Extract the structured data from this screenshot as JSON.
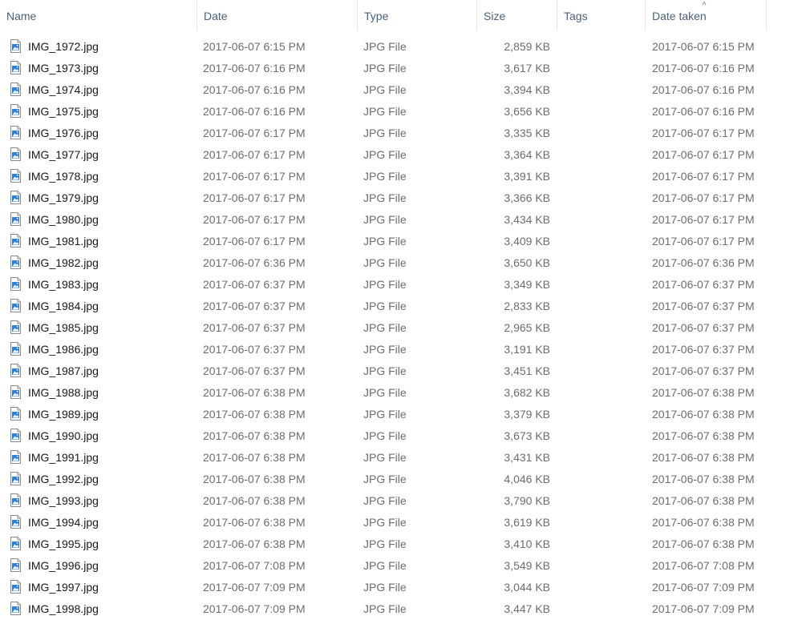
{
  "columns": {
    "name": "Name",
    "date": "Date",
    "type": "Type",
    "size": "Size",
    "tags": "Tags",
    "date_taken": "Date taken",
    "sort_indicator": "^"
  },
  "accent_color": "#4c607a",
  "file_icon": "image-file-icon",
  "files": [
    {
      "name": "IMG_1972.jpg",
      "date": "2017-06-07 6:15 PM",
      "type": "JPG File",
      "size": "2,859 KB",
      "tags": "",
      "date_taken": "2017-06-07 6:15 PM"
    },
    {
      "name": "IMG_1973.jpg",
      "date": "2017-06-07 6:16 PM",
      "type": "JPG File",
      "size": "3,617 KB",
      "tags": "",
      "date_taken": "2017-06-07 6:16 PM"
    },
    {
      "name": "IMG_1974.jpg",
      "date": "2017-06-07 6:16 PM",
      "type": "JPG File",
      "size": "3,394 KB",
      "tags": "",
      "date_taken": "2017-06-07 6:16 PM"
    },
    {
      "name": "IMG_1975.jpg",
      "date": "2017-06-07 6:16 PM",
      "type": "JPG File",
      "size": "3,656 KB",
      "tags": "",
      "date_taken": "2017-06-07 6:16 PM"
    },
    {
      "name": "IMG_1976.jpg",
      "date": "2017-06-07 6:17 PM",
      "type": "JPG File",
      "size": "3,335 KB",
      "tags": "",
      "date_taken": "2017-06-07 6:17 PM"
    },
    {
      "name": "IMG_1977.jpg",
      "date": "2017-06-07 6:17 PM",
      "type": "JPG File",
      "size": "3,364 KB",
      "tags": "",
      "date_taken": "2017-06-07 6:17 PM"
    },
    {
      "name": "IMG_1978.jpg",
      "date": "2017-06-07 6:17 PM",
      "type": "JPG File",
      "size": "3,391 KB",
      "tags": "",
      "date_taken": "2017-06-07 6:17 PM"
    },
    {
      "name": "IMG_1979.jpg",
      "date": "2017-06-07 6:17 PM",
      "type": "JPG File",
      "size": "3,366 KB",
      "tags": "",
      "date_taken": "2017-06-07 6:17 PM"
    },
    {
      "name": "IMG_1980.jpg",
      "date": "2017-06-07 6:17 PM",
      "type": "JPG File",
      "size": "3,434 KB",
      "tags": "",
      "date_taken": "2017-06-07 6:17 PM"
    },
    {
      "name": "IMG_1981.jpg",
      "date": "2017-06-07 6:17 PM",
      "type": "JPG File",
      "size": "3,409 KB",
      "tags": "",
      "date_taken": "2017-06-07 6:17 PM"
    },
    {
      "name": "IMG_1982.jpg",
      "date": "2017-06-07 6:36 PM",
      "type": "JPG File",
      "size": "3,650 KB",
      "tags": "",
      "date_taken": "2017-06-07 6:36 PM"
    },
    {
      "name": "IMG_1983.jpg",
      "date": "2017-06-07 6:37 PM",
      "type": "JPG File",
      "size": "3,349 KB",
      "tags": "",
      "date_taken": "2017-06-07 6:37 PM"
    },
    {
      "name": "IMG_1984.jpg",
      "date": "2017-06-07 6:37 PM",
      "type": "JPG File",
      "size": "2,833 KB",
      "tags": "",
      "date_taken": "2017-06-07 6:37 PM"
    },
    {
      "name": "IMG_1985.jpg",
      "date": "2017-06-07 6:37 PM",
      "type": "JPG File",
      "size": "2,965 KB",
      "tags": "",
      "date_taken": "2017-06-07 6:37 PM"
    },
    {
      "name": "IMG_1986.jpg",
      "date": "2017-06-07 6:37 PM",
      "type": "JPG File",
      "size": "3,191 KB",
      "tags": "",
      "date_taken": "2017-06-07 6:37 PM"
    },
    {
      "name": "IMG_1987.jpg",
      "date": "2017-06-07 6:37 PM",
      "type": "JPG File",
      "size": "3,451 KB",
      "tags": "",
      "date_taken": "2017-06-07 6:37 PM"
    },
    {
      "name": "IMG_1988.jpg",
      "date": "2017-06-07 6:38 PM",
      "type": "JPG File",
      "size": "3,682 KB",
      "tags": "",
      "date_taken": "2017-06-07 6:38 PM"
    },
    {
      "name": "IMG_1989.jpg",
      "date": "2017-06-07 6:38 PM",
      "type": "JPG File",
      "size": "3,379 KB",
      "tags": "",
      "date_taken": "2017-06-07 6:38 PM"
    },
    {
      "name": "IMG_1990.jpg",
      "date": "2017-06-07 6:38 PM",
      "type": "JPG File",
      "size": "3,673 KB",
      "tags": "",
      "date_taken": "2017-06-07 6:38 PM"
    },
    {
      "name": "IMG_1991.jpg",
      "date": "2017-06-07 6:38 PM",
      "type": "JPG File",
      "size": "3,431 KB",
      "tags": "",
      "date_taken": "2017-06-07 6:38 PM"
    },
    {
      "name": "IMG_1992.jpg",
      "date": "2017-06-07 6:38 PM",
      "type": "JPG File",
      "size": "4,046 KB",
      "tags": "",
      "date_taken": "2017-06-07 6:38 PM"
    },
    {
      "name": "IMG_1993.jpg",
      "date": "2017-06-07 6:38 PM",
      "type": "JPG File",
      "size": "3,790 KB",
      "tags": "",
      "date_taken": "2017-06-07 6:38 PM"
    },
    {
      "name": "IMG_1994.jpg",
      "date": "2017-06-07 6:38 PM",
      "type": "JPG File",
      "size": "3,619 KB",
      "tags": "",
      "date_taken": "2017-06-07 6:38 PM"
    },
    {
      "name": "IMG_1995.jpg",
      "date": "2017-06-07 6:38 PM",
      "type": "JPG File",
      "size": "3,410 KB",
      "tags": "",
      "date_taken": "2017-06-07 6:38 PM"
    },
    {
      "name": "IMG_1996.jpg",
      "date": "2017-06-07 7:08 PM",
      "type": "JPG File",
      "size": "3,549 KB",
      "tags": "",
      "date_taken": "2017-06-07 7:08 PM"
    },
    {
      "name": "IMG_1997.jpg",
      "date": "2017-06-07 7:09 PM",
      "type": "JPG File",
      "size": "3,044 KB",
      "tags": "",
      "date_taken": "2017-06-07 7:09 PM"
    },
    {
      "name": "IMG_1998.jpg",
      "date": "2017-06-07 7:09 PM",
      "type": "JPG File",
      "size": "3,447 KB",
      "tags": "",
      "date_taken": "2017-06-07 7:09 PM"
    }
  ]
}
